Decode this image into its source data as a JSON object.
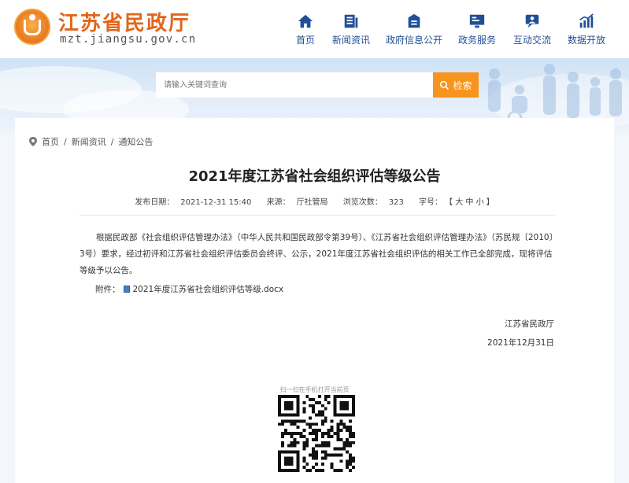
{
  "header": {
    "site_title": "江苏省民政厅",
    "site_domain": "mzt.jiangsu.gov.cn",
    "brand_color": "#e2651b",
    "nav": [
      {
        "label": "首页",
        "icon": "home-icon"
      },
      {
        "label": "新闻资讯",
        "icon": "news-icon"
      },
      {
        "label": "政府信息公开",
        "icon": "document-icon"
      },
      {
        "label": "政务服务",
        "icon": "monitor-icon"
      },
      {
        "label": "互动交流",
        "icon": "chat-icon"
      },
      {
        "label": "数据开放",
        "icon": "chart-icon"
      }
    ]
  },
  "search": {
    "placeholder": "请输入关键词查询",
    "button_label": "检索",
    "button_color": "#f7941d"
  },
  "breadcrumb": {
    "items": [
      "首页",
      "新闻资讯",
      "通知公告"
    ],
    "separator": "/"
  },
  "article": {
    "title": "2021年度江苏省社会组织评估等级公告",
    "meta": {
      "publish_label": "发布日期：",
      "publish_date": "2021-12-31 15:40",
      "source_label": "来源：",
      "source": "厅社管局",
      "views_label": "浏览次数：",
      "views": "323",
      "font_label": "字号：",
      "font_sizes": "【 大 中 小 】"
    },
    "body": "根据民政部《社会组织评估管理办法》（中华人民共和国民政部令第39号）、《江苏省社会组织评估管理办法》（苏民规〔2010〕3号）要求，经过初评和江苏省社会组织评估委员会终评、公示，2021年度江苏省社会组织评估的相关工作已全部完成，现将评估等级予以公告。",
    "attachment_label": "附件：",
    "attachment_name": "2021年度江苏省社会组织评估等级.docx",
    "sign_org": "江苏省民政厅",
    "sign_date": "2021年12月31日"
  },
  "qr": {
    "label": "扫一扫在手机打开当前页"
  }
}
